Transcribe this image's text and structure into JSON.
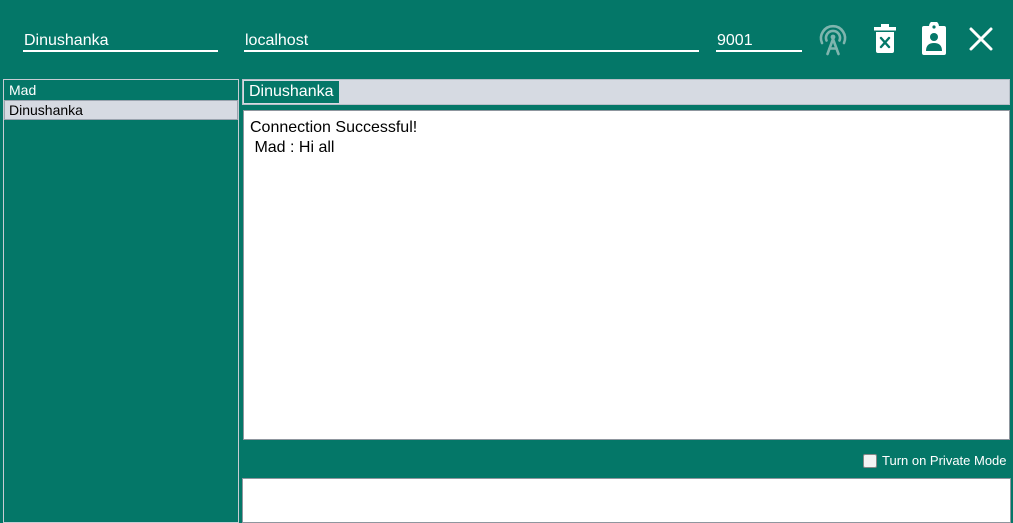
{
  "header": {
    "username": "Dinushanka",
    "host": "localhost",
    "port": "9001",
    "icons": [
      "antenna-icon",
      "delete-icon",
      "clipboard-user-icon",
      "close-icon"
    ]
  },
  "users": [
    {
      "name": "Mad",
      "selected": false
    },
    {
      "name": "Dinushanka",
      "selected": true
    }
  ],
  "chat": {
    "tab_label": "Dinushanka",
    "messages": [
      "Connection Successful!",
      " Mad : Hi all"
    ],
    "input_value": ""
  },
  "private_mode": {
    "label": "Turn on Private Mode",
    "checked": false
  },
  "colors": {
    "accent": "#047768",
    "selection": "#d6dae2"
  }
}
